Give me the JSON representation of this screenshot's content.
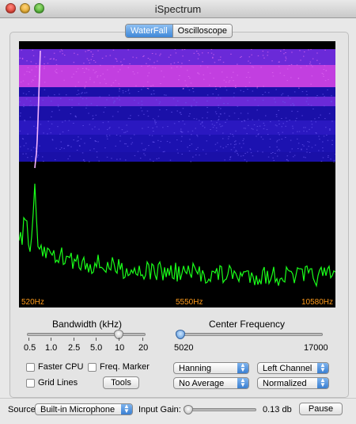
{
  "window": {
    "title": "iSpectrum"
  },
  "tabs": [
    {
      "label": "WaterFall",
      "active": true
    },
    {
      "label": "Oscilloscope",
      "active": false
    }
  ],
  "spectrum": {
    "freq_labels": [
      "520Hz",
      "5550Hz",
      "10580Hz"
    ],
    "trace_color": "#1aff1a",
    "label_color": "#ff9a1a",
    "waterfall_colors": [
      "#1a10a8",
      "#6a2ad8",
      "#c23fe0"
    ]
  },
  "bandwidth": {
    "heading": "Bandwidth (kHz)",
    "ticks": [
      "0.5",
      "1.0",
      "2.5",
      "5.0",
      "10",
      "20"
    ],
    "selected_index": 4
  },
  "center_frequency": {
    "heading": "Center Frequency",
    "min_label": "5020",
    "max_label": "17000",
    "value_fraction": 0.0
  },
  "options": {
    "faster_cpu": {
      "label": "Faster CPU",
      "checked": false
    },
    "freq_marker": {
      "label": "Freq. Marker",
      "checked": false
    },
    "grid_lines": {
      "label": "Grid Lines",
      "checked": false
    },
    "tools_button": "Tools"
  },
  "popups": {
    "window_fn": "Hanning",
    "channel": "Left Channel",
    "averaging": "No Average",
    "scale": "Normalized"
  },
  "bottom": {
    "source_label": "Source:",
    "source_value": "Built-in Microphone",
    "gain_label": "Input Gain:",
    "gain_value": "0.13 db",
    "gain_fraction": 0.0,
    "pause_button": "Pause"
  }
}
